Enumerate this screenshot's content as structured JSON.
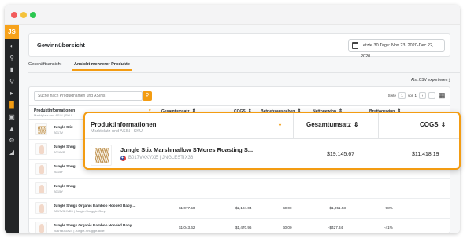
{
  "app": {
    "logo": "JS"
  },
  "sidebar": {
    "icons": [
      "camera-icon",
      "search-icon",
      "book-icon",
      "key-icon",
      "megaphone-icon",
      "analytics-icon",
      "monitor-icon",
      "graduation-cap-icon",
      "gear-icon",
      "cart-icon"
    ],
    "active": "analytics-icon"
  },
  "header": {
    "title": "Gewinnübersicht",
    "date_range": "Letzte 30 Tage: Nov 23, 2020-Dec 22, 2020"
  },
  "tabs": [
    {
      "label": "Geschäftsansicht",
      "active": false
    },
    {
      "label": "Ansicht mehrerer Produkte",
      "active": true
    }
  ],
  "export_label": "Als .CSV exportieren",
  "search": {
    "placeholder": "Suche nach Produktnamen und ASINs"
  },
  "pagination": {
    "label": "Seite",
    "current": "1",
    "of": "von 1"
  },
  "table": {
    "columns": {
      "product": "Produktinformationen",
      "product_sub": "Marktplatz und ASIN | SKU",
      "revenue": "Gesamtumsatz",
      "cogs": "COGS",
      "expenses": "Betriebsausgaben",
      "net": "Nettogewinn",
      "gross": "Bruttogewinn"
    },
    "rows": [
      {
        "title": "Jungle Stix",
        "sub": "B017V"
      },
      {
        "title": "Jungle Snug",
        "sub": "B016YB"
      },
      {
        "title": "Jungle Snug",
        "sub": "B015Y"
      },
      {
        "title": "Jungle Snug",
        "sub": "B015Y"
      },
      {
        "title": "Jungle Snugs Organic Bamboo Hooded Baby ...",
        "sub": "B017V5KVD5 | Jungle-Snuggle-Grey",
        "revenue": "$1,077.50",
        "cogs": "$2,124.04",
        "expenses": "$0.00",
        "net": "-$1,051.53",
        "gross": "-98%"
      },
      {
        "title": "Jungle Snugs Organic Bamboo Hooded Baby ...",
        "sub": "B06YB43XZ4 | Jungle-Snuggle-Blue",
        "revenue": "$1,043.62",
        "cogs": "$1,470.96",
        "expenses": "$0.00",
        "net": "-$427.34",
        "gross": "-41%"
      }
    ]
  },
  "overlay": {
    "product_header": "Produktinformationen",
    "product_sub": "Marktplatz und ASIN | SKU",
    "revenue_header": "Gesamtumsatz",
    "cogs_header": "COGS",
    "title": "Jungle Stix Marshmallow S'Mores Roasting S...",
    "code": "B017VXKVXE | JNGLESTIX36",
    "revenue": "$19,145.67",
    "cogs": "$11,418.19"
  }
}
